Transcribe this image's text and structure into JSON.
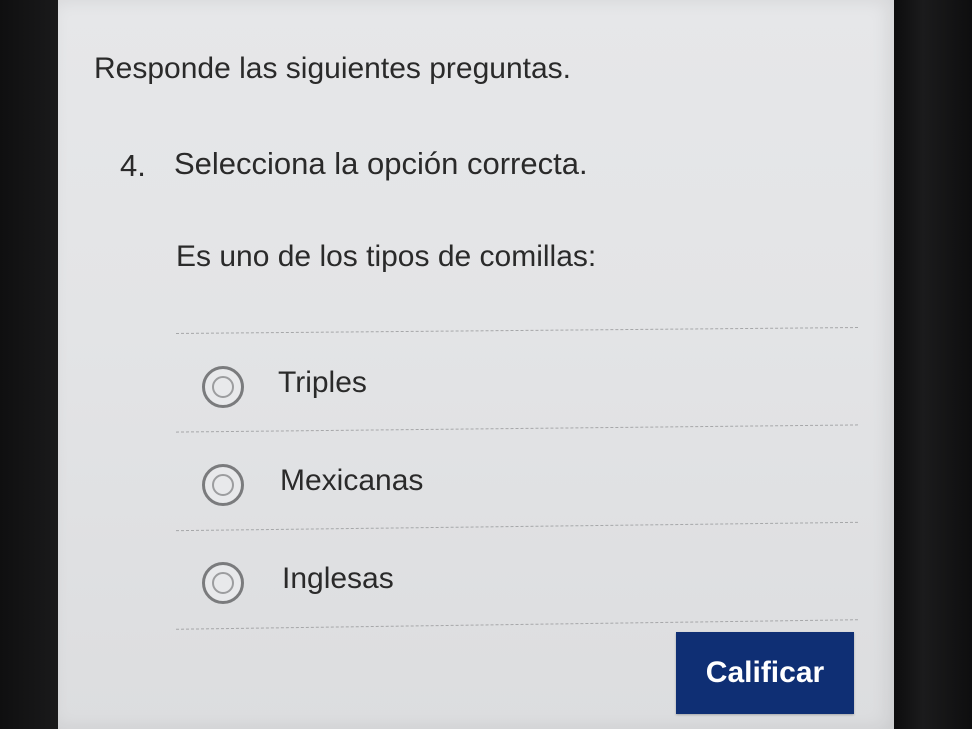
{
  "intro": "Responde las siguientes preguntas.",
  "question": {
    "number": "4.",
    "title": "Selecciona la opción correcta.",
    "prompt": "Es uno de los tipos de comillas:",
    "options": [
      {
        "label": "Triples"
      },
      {
        "label": "Mexicanas"
      },
      {
        "label": "Inglesas"
      }
    ]
  },
  "submit_label": "Calificar",
  "colors": {
    "button": "#0f2f74",
    "background": "#e4e5e7",
    "text": "#2a2a2a"
  },
  "icons": {
    "option_marker": "radio-unselected-icon"
  }
}
